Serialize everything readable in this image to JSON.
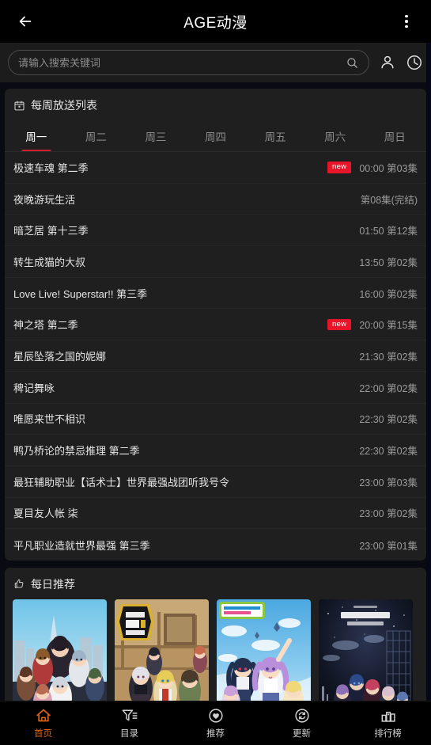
{
  "titlebar": {
    "back_icon": "arrow-left-icon",
    "title": "AGE动漫",
    "more_icon": "overflow-menu-icon"
  },
  "search": {
    "placeholder": "请输入搜索关键词",
    "value": "",
    "search_icon": "search-icon",
    "user_icon": "user-account-icon",
    "history_icon": "clock-history-icon"
  },
  "schedule": {
    "icon": "calendar-icon",
    "title": "每周放送列表",
    "tabs": [
      {
        "label": "周一",
        "active": true
      },
      {
        "label": "周二",
        "active": false
      },
      {
        "label": "周三",
        "active": false
      },
      {
        "label": "周四",
        "active": false
      },
      {
        "label": "周五",
        "active": false
      },
      {
        "label": "周六",
        "active": false
      },
      {
        "label": "周日",
        "active": false
      }
    ],
    "badge_label": "new",
    "rows": [
      {
        "name": "极速车魂 第二季",
        "badge": "new",
        "meta": "00:00 第03集"
      },
      {
        "name": "夜晚游玩生活",
        "badge": "",
        "meta": "第08集(完结)"
      },
      {
        "name": "暗芝居 第十三季",
        "badge": "",
        "meta": "01:50 第12集"
      },
      {
        "name": "转生成猫的大叔",
        "badge": "",
        "meta": "13:50 第02集"
      },
      {
        "name": "Love Live! Superstar!! 第三季",
        "badge": "",
        "meta": "16:00 第02集"
      },
      {
        "name": "神之塔 第二季",
        "badge": "new",
        "meta": "20:00 第15集"
      },
      {
        "name": "星辰坠落之国的妮娜",
        "badge": "",
        "meta": "21:30 第02集"
      },
      {
        "name": "稗记舞咏",
        "badge": "",
        "meta": "22:00 第02集"
      },
      {
        "name": "唯愿来世不相识",
        "badge": "",
        "meta": "22:30 第02集"
      },
      {
        "name": "鸭乃桥论的禁忌推理 第二季",
        "badge": "",
        "meta": "22:30 第02集"
      },
      {
        "name": "最狂辅助职业【话术士】世界最强战团听我号令",
        "badge": "",
        "meta": "23:00 第03集"
      },
      {
        "name": "夏目友人帐 柒",
        "badge": "",
        "meta": "23:00 第02集"
      },
      {
        "name": "平凡职业造就世界最强 第三季",
        "badge": "",
        "meta": "23:00 第01集"
      }
    ]
  },
  "recommend": {
    "icon": "thumbs-up-icon",
    "title": "每日推荐",
    "posters": [
      {
        "alt": "anime-poster-1"
      },
      {
        "alt": "anime-poster-2"
      },
      {
        "alt": "anime-poster-3"
      },
      {
        "alt": "anime-poster-4"
      }
    ]
  },
  "bottomnav": {
    "items": [
      {
        "label": "首页",
        "icon": "home-icon",
        "active": true
      },
      {
        "label": "目录",
        "icon": "filter-list-icon",
        "active": false
      },
      {
        "label": "推荐",
        "icon": "heart-circle-icon",
        "active": false
      },
      {
        "label": "更新",
        "icon": "refresh-circle-icon",
        "active": false
      },
      {
        "label": "排行榜",
        "icon": "bar-chart-icon",
        "active": false
      }
    ]
  },
  "colors": {
    "accent_red": "#d4202e",
    "badge_red": "#e8152a",
    "active_nav": "#e2640d",
    "card_bg": "#1f1f1f",
    "page_bg": "#0a0a12"
  }
}
